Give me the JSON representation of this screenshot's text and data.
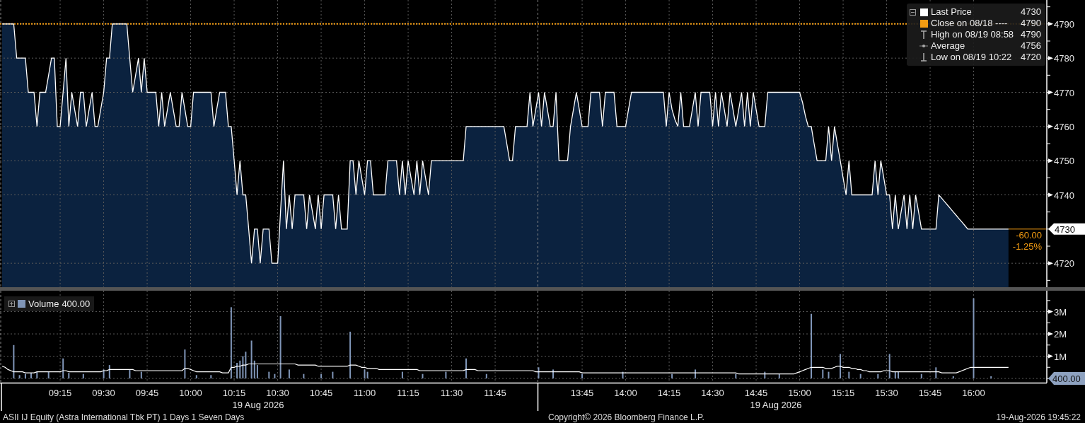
{
  "price_chart": {
    "legend": [
      {
        "kind": "series",
        "value": "4730"
      },
      {
        "kind": "swatch",
        "label": "Close on 08/18 ----",
        "value": "4790",
        "color": "#f39c12"
      },
      {
        "kind": "high",
        "label": "High on 08/19 08:58",
        "value": "4790"
      },
      {
        "kind": "average",
        "label": "Average",
        "value": "4756"
      },
      {
        "kind": "low",
        "label": "Low on 08/19 10:22",
        "value": "4720"
      }
    ],
    "last_price_tag": "4730",
    "change": "-60.00",
    "change_percent": "-1.25%",
    "chart_data": {
      "type": "area",
      "grid": true,
      "ylim": [
        4713,
        4797
      ],
      "yticks": [
        4720,
        4740,
        4750,
        4760,
        4770,
        4780,
        4790
      ],
      "ref_lines": [
        {
          "axis": "y",
          "value": 4790,
          "color": "#f39c12"
        }
      ],
      "categories": [
        null,
        null,
        null,
        null,
        null,
        null,
        null,
        null,
        null,
        null,
        null,
        null,
        null,
        null,
        null,
        null,
        null,
        null,
        null,
        null,
        null,
        null,
        null,
        null,
        null,
        null,
        null,
        null,
        null,
        null,
        null,
        null,
        null,
        null,
        null,
        null,
        null,
        null,
        null,
        null,
        null,
        null,
        null,
        null,
        null,
        null,
        null,
        null,
        null,
        null,
        null,
        null,
        null,
        null,
        null,
        null,
        null,
        null,
        null,
        null,
        null,
        null,
        null,
        null,
        null,
        null,
        null,
        null,
        null,
        null,
        null,
        null,
        null,
        null,
        null,
        null,
        null,
        null,
        null,
        null,
        null,
        null,
        null,
        null,
        null,
        null,
        null,
        null,
        null,
        null,
        null,
        null,
        null,
        null,
        null,
        null,
        null,
        null,
        null,
        null,
        null,
        null,
        null,
        null,
        null,
        null,
        null,
        null,
        null,
        null,
        null,
        null,
        null,
        null,
        null,
        null,
        null,
        null,
        null,
        null,
        null,
        null,
        null,
        null,
        null,
        null,
        null,
        null,
        null,
        null,
        null,
        null,
        null,
        null,
        null,
        null,
        null,
        null,
        null,
        null,
        null,
        null,
        null,
        null,
        null,
        null,
        null,
        null,
        null,
        null,
        null,
        null,
        null,
        null,
        null,
        null,
        null,
        null,
        null,
        null,
        null,
        null,
        null,
        null,
        null,
        null,
        null,
        null,
        null,
        null,
        null,
        null,
        null,
        null,
        null,
        null,
        null,
        null,
        null,
        null,
        null,
        null,
        null,
        null,
        null,
        null,
        null,
        null,
        null,
        null,
        null,
        null,
        null,
        null,
        null,
        null,
        null,
        null,
        null,
        null,
        null,
        null,
        null,
        null,
        null,
        null,
        null,
        null,
        null,
        null,
        null,
        null,
        null,
        null,
        null,
        null,
        null,
        null,
        null,
        null,
        null,
        null,
        null,
        null,
        null,
        null,
        null,
        null,
        null,
        null,
        null,
        null,
        null,
        null,
        null,
        null,
        null,
        null,
        null,
        null,
        null,
        null,
        null,
        null,
        null,
        null,
        null,
        null,
        null,
        null,
        null,
        null,
        null,
        null,
        null,
        null,
        null,
        null,
        null,
        null,
        null,
        null,
        null,
        null,
        null,
        null,
        null,
        null,
        null,
        null,
        null,
        null,
        null,
        null,
        null,
        null,
        null,
        null,
        null,
        null,
        null,
        null,
        null,
        null,
        null,
        null,
        null,
        null,
        null,
        null,
        null,
        null,
        null,
        null,
        null,
        null,
        null,
        null,
        null,
        null,
        null,
        null,
        null,
        null,
        null,
        null,
        null,
        null,
        null,
        null,
        null,
        null,
        null,
        null,
        null,
        null,
        null,
        null,
        null,
        null,
        null,
        null,
        null,
        null,
        null,
        null,
        null,
        null,
        null,
        null,
        null,
        null,
        null,
        null,
        null,
        null,
        null,
        null,
        null,
        null,
        null,
        null,
        null,
        null,
        null,
        null,
        null,
        null,
        null,
        null,
        null,
        null,
        null,
        null,
        null,
        null,
        null,
        null,
        null,
        null
      ],
      "series": [
        {
          "name": "Last Price",
          "color": "#ffffff",
          "values": [
            4790,
            4790,
            4790,
            4790,
            4790,
            4780,
            4780,
            4780,
            4780,
            4770,
            4770,
            4770,
            4760,
            4770,
            4770,
            4770,
            4775,
            4780,
            4780,
            4760,
            4760,
            4770,
            4780,
            4760,
            4770,
            4765,
            4760,
            4770,
            4770,
            4760,
            4765,
            4770,
            4760,
            4760,
            4765,
            4770,
            4780,
            4780,
            4790,
            4790,
            4790,
            4790,
            4790,
            4790,
            4780,
            4770,
            4775,
            4780,
            4770,
            4780,
            4770,
            4770,
            4770,
            4770,
            4760,
            4770,
            4760,
            4765,
            4770,
            4765,
            4760,
            4760,
            4770,
            4765,
            4760,
            4760,
            4770,
            4770,
            4770,
            4770,
            4770,
            4770,
            4770,
            4760,
            4765,
            4770,
            4770,
            4770,
            4760,
            4760,
            4750,
            4740,
            4750,
            4740,
            4740,
            4730,
            4720,
            4730,
            4730,
            4720,
            4730,
            4730,
            4730,
            4720,
            4720,
            4720,
            4735,
            4750,
            4730,
            4740,
            4730,
            4740,
            4740,
            4740,
            4740,
            4730,
            4740,
            4735,
            4730,
            4740,
            4730,
            4740,
            4740,
            4740,
            4740,
            4730,
            4740,
            4730,
            4730,
            4730,
            4750,
            4750,
            4740,
            4750,
            4745,
            4740,
            4750,
            4750,
            4740,
            4740,
            4740,
            4740,
            4740,
            4750,
            4750,
            4750,
            4750,
            4740,
            4750,
            4740,
            4750,
            4745,
            4740,
            4750,
            4740,
            4750,
            4745,
            4740,
            4750,
            4750,
            4750,
            4750,
            4750,
            4750,
            4750,
            4750,
            4750,
            4750,
            4750,
            4750,
            4760,
            4760,
            4760,
            4760,
            4760,
            4760,
            4760,
            4760,
            4760,
            4760,
            4760,
            4760,
            4760,
            4760,
            4755,
            4750,
            4750,
            4760,
            4760,
            4760,
            4760,
            4760,
            4770,
            4760,
            4765,
            4770,
            4760,
            4770,
            4765,
            4760,
            4760,
            4770,
            4750,
            4750,
            4750,
            4750,
            4760,
            4765,
            4770,
            4765,
            4760,
            4760,
            4760,
            4770,
            4770,
            4770,
            4770,
            4760,
            4770,
            4770,
            4770,
            4770,
            4760,
            4760,
            4760,
            4760,
            4765,
            4770,
            4770,
            4770,
            4770,
            4770,
            4770,
            4770,
            4770,
            4770,
            4770,
            4770,
            4770,
            4760,
            4770,
            4765,
            4762,
            4760,
            4770,
            4760,
            4760,
            4760,
            4765,
            4770,
            4760,
            4770,
            4770,
            4770,
            4770,
            4760,
            4770,
            4760,
            4770,
            4765,
            4760,
            4770,
            4765,
            4760,
            4765,
            4770,
            4760,
            4770,
            4760,
            4770,
            4765,
            4760,
            4760,
            4760,
            4770,
            4770,
            4770,
            4770,
            4770,
            4770,
            4770,
            4770,
            4770,
            4770,
            4770,
            4770,
            4767,
            4763,
            4760,
            4760,
            4755,
            4750,
            4750,
            4750,
            4750,
            4760,
            4750,
            4760,
            4755,
            4750,
            4745,
            4740,
            4750,
            4740,
            4740,
            4740,
            4740,
            4740,
            4740,
            4740,
            4740,
            4750,
            4740,
            4750,
            4745,
            4740,
            4740,
            4730,
            4740,
            4730,
            4735,
            4740,
            4730,
            4740,
            4730,
            4740,
            4735,
            4730,
            4730,
            4730,
            4730,
            4730,
            4730,
            4740,
            4739,
            4738,
            4737,
            4736,
            4735,
            4734,
            4733,
            4732,
            4731,
            4730,
            4730,
            4730,
            4730,
            4730,
            4730,
            4730,
            4730,
            4730,
            4730,
            4730,
            4730,
            4730,
            4730,
            4730,
            null,
            null,
            null,
            null,
            null,
            null,
            null,
            null,
            null,
            null,
            null,
            null
          ]
        }
      ]
    }
  },
  "volume_chart": {
    "legend": {
      "value": "400.00"
    },
    "last_volume_tag": "400.00",
    "chart_data": {
      "type": "bar",
      "grid": true,
      "ylim": [
        0,
        3940000
      ],
      "yticks": [
        {
          "value": 1000000,
          "label": "1M"
        },
        {
          "value": 2000000,
          "label": "2M"
        },
        {
          "value": 3000000,
          "label": "3M"
        }
      ],
      "categories": [
        null,
        null,
        null,
        null,
        null,
        null,
        null,
        null,
        null,
        null,
        null,
        null,
        null,
        null,
        null,
        null,
        null,
        null,
        null,
        null,
        "09:15",
        null,
        null,
        null,
        null,
        null,
        null,
        null,
        null,
        null,
        null,
        null,
        null,
        null,
        null,
        "09:30",
        null,
        null,
        null,
        null,
        null,
        null,
        null,
        null,
        null,
        null,
        null,
        null,
        null,
        null,
        "09:45",
        null,
        null,
        null,
        null,
        null,
        null,
        null,
        null,
        null,
        null,
        null,
        null,
        null,
        null,
        "10:00",
        null,
        null,
        null,
        null,
        null,
        null,
        null,
        null,
        null,
        null,
        null,
        null,
        null,
        null,
        "10:15",
        null,
        null,
        null,
        null,
        null,
        null,
        null,
        null,
        null,
        null,
        null,
        null,
        null,
        null,
        "10:30",
        null,
        null,
        null,
        null,
        null,
        null,
        null,
        null,
        null,
        null,
        null,
        null,
        null,
        null,
        "10:45",
        null,
        null,
        null,
        null,
        null,
        null,
        null,
        null,
        null,
        null,
        null,
        null,
        null,
        null,
        "11:00",
        null,
        null,
        null,
        null,
        null,
        null,
        null,
        null,
        null,
        null,
        null,
        null,
        null,
        null,
        "11:15",
        null,
        null,
        null,
        null,
        null,
        null,
        null,
        null,
        null,
        null,
        null,
        null,
        null,
        null,
        "11:30",
        null,
        null,
        null,
        null,
        null,
        null,
        null,
        null,
        null,
        null,
        null,
        null,
        null,
        null,
        "11:45",
        null,
        null,
        null,
        null,
        null,
        null,
        null,
        null,
        null,
        null,
        null,
        null,
        null,
        null,
        null,
        null,
        null,
        null,
        null,
        null,
        null,
        null,
        null,
        null,
        null,
        null,
        null,
        null,
        null,
        "13:45",
        null,
        null,
        null,
        null,
        null,
        null,
        null,
        null,
        null,
        null,
        null,
        null,
        null,
        null,
        "14:00",
        null,
        null,
        null,
        null,
        null,
        null,
        null,
        null,
        null,
        null,
        null,
        null,
        null,
        null,
        "14:15",
        null,
        null,
        null,
        null,
        null,
        null,
        null,
        null,
        null,
        null,
        null,
        null,
        null,
        null,
        "14:30",
        null,
        null,
        null,
        null,
        null,
        null,
        null,
        null,
        null,
        null,
        null,
        null,
        null,
        null,
        "14:45",
        null,
        null,
        null,
        null,
        null,
        null,
        null,
        null,
        null,
        null,
        null,
        null,
        null,
        null,
        "15:00",
        null,
        null,
        null,
        null,
        null,
        null,
        null,
        null,
        null,
        null,
        null,
        null,
        null,
        null,
        "15:15",
        null,
        null,
        null,
        null,
        null,
        null,
        null,
        null,
        null,
        null,
        null,
        null,
        null,
        null,
        "15:30",
        null,
        null,
        null,
        null,
        null,
        null,
        null,
        null,
        null,
        null,
        null,
        null,
        null,
        null,
        "15:45",
        null,
        null,
        null,
        null,
        null,
        null,
        null,
        null,
        null,
        null,
        null,
        null,
        null,
        null,
        "16:00",
        null,
        null,
        null,
        null,
        null,
        null,
        null,
        null,
        null,
        null,
        null,
        null,
        null,
        null,
        null,
        null,
        null,
        null,
        null,
        null,
        null,
        null,
        null,
        null
      ],
      "series": [
        {
          "name": "Volume",
          "color": "#8096b8",
          "values": [
            null,
            null,
            null,
            null,
            1500000,
            null,
            150000,
            null,
            200000,
            null,
            250000,
            null,
            300000,
            null,
            null,
            null,
            300000,
            null,
            null,
            null,
            null,
            900000,
            null,
            250000,
            null,
            null,
            null,
            null,
            200000,
            null,
            null,
            null,
            null,
            null,
            null,
            400000,
            null,
            600000,
            null,
            null,
            null,
            null,
            null,
            null,
            400000,
            null,
            null,
            null,
            300000,
            null,
            null,
            null,
            null,
            null,
            null,
            null,
            null,
            null,
            null,
            null,
            null,
            null,
            null,
            1300000,
            null,
            null,
            null,
            150000,
            null,
            null,
            null,
            null,
            150000,
            null,
            null,
            null,
            null,
            null,
            null,
            3200000,
            null,
            700000,
            800000,
            1000000,
            1200000,
            null,
            1700000,
            800000,
            600000,
            null,
            null,
            null,
            300000,
            null,
            200000,
            null,
            2800000,
            null,
            null,
            400000,
            null,
            null,
            null,
            null,
            200000,
            null,
            null,
            null,
            null,
            null,
            200000,
            null,
            null,
            null,
            300000,
            null,
            null,
            null,
            null,
            null,
            2100000,
            null,
            null,
            null,
            null,
            400000,
            300000,
            null,
            null,
            null,
            null,
            null,
            null,
            null,
            null,
            null,
            null,
            null,
            300000,
            null,
            null,
            null,
            null,
            null,
            null,
            200000,
            null,
            null,
            null,
            null,
            null,
            null,
            null,
            300000,
            null,
            null,
            null,
            null,
            null,
            null,
            900000,
            null,
            null,
            null,
            null,
            null,
            null,
            200000,
            null,
            null,
            null,
            null,
            null,
            null,
            null,
            null,
            null,
            null,
            null,
            null,
            null,
            null,
            null,
            null,
            null,
            500000,
            null,
            null,
            null,
            null,
            400000,
            null,
            null,
            null,
            null,
            null,
            null,
            null,
            null,
            null,
            200000,
            null,
            null,
            null,
            null,
            null,
            null,
            null,
            null,
            null,
            null,
            null,
            null,
            null,
            300000,
            null,
            null,
            null,
            null,
            null,
            null,
            null,
            null,
            null,
            null,
            null,
            null,
            null,
            null,
            null,
            null,
            200000,
            null,
            null,
            null,
            null,
            null,
            null,
            null,
            400000,
            null,
            null,
            null,
            null,
            null,
            null,
            null,
            null,
            null,
            null,
            null,
            null,
            null,
            200000,
            null,
            null,
            null,
            null,
            null,
            null,
            null,
            null,
            null,
            300000,
            null,
            null,
            null,
            null,
            200000,
            null,
            null,
            null,
            null,
            null,
            null,
            null,
            null,
            null,
            null,
            2900000,
            null,
            null,
            null,
            400000,
            null,
            300000,
            null,
            null,
            null,
            1100000,
            null,
            null,
            300000,
            null,
            null,
            null,
            200000,
            null,
            null,
            null,
            null,
            null,
            200000,
            null,
            null,
            null,
            1100000,
            null,
            300000,
            300000,
            null,
            null,
            null,
            null,
            null,
            null,
            null,
            200000,
            null,
            null,
            null,
            null,
            500000,
            null,
            null,
            null,
            null,
            null,
            100000,
            null,
            null,
            null,
            null,
            null,
            null,
            3600000,
            null,
            null,
            null,
            null,
            null,
            100000,
            null,
            null,
            null,
            null,
            null,
            null,
            null,
            null,
            null,
            null,
            null,
            null,
            null,
            null,
            null,
            null,
            null,
            null
          ]
        },
        {
          "type": "line",
          "color": "#ffffff",
          "values": [
            550000,
            500000,
            400000,
            350000,
            300000,
            300000,
            300000,
            300000,
            250000,
            250000,
            250000,
            250000,
            300000,
            300000,
            300000,
            300000,
            300000,
            300000,
            300000,
            300000,
            300000,
            350000,
            350000,
            300000,
            300000,
            300000,
            300000,
            300000,
            300000,
            300000,
            300000,
            300000,
            300000,
            300000,
            300000,
            350000,
            350000,
            400000,
            400000,
            400000,
            400000,
            400000,
            400000,
            400000,
            400000,
            400000,
            350000,
            350000,
            350000,
            350000,
            350000,
            350000,
            350000,
            350000,
            350000,
            350000,
            350000,
            350000,
            350000,
            350000,
            350000,
            350000,
            350000,
            450000,
            450000,
            400000,
            350000,
            300000,
            300000,
            300000,
            300000,
            300000,
            300000,
            300000,
            300000,
            300000,
            250000,
            250000,
            250000,
            500000,
            500000,
            550000,
            550000,
            600000,
            600000,
            650000,
            650000,
            650000,
            650000,
            650000,
            650000,
            650000,
            650000,
            650000,
            650000,
            650000,
            650000,
            650000,
            650000,
            650000,
            650000,
            650000,
            600000,
            600000,
            600000,
            600000,
            600000,
            600000,
            600000,
            550000,
            550000,
            550000,
            550000,
            550000,
            550000,
            550000,
            550000,
            550000,
            550000,
            550000,
            600000,
            600000,
            600000,
            550000,
            500000,
            500000,
            450000,
            450000,
            450000,
            450000,
            400000,
            400000,
            400000,
            400000,
            400000,
            400000,
            400000,
            400000,
            400000,
            400000,
            400000,
            400000,
            400000,
            400000,
            350000,
            350000,
            350000,
            350000,
            350000,
            350000,
            350000,
            350000,
            350000,
            350000,
            350000,
            350000,
            350000,
            350000,
            350000,
            350000,
            400000,
            400000,
            400000,
            400000,
            350000,
            350000,
            350000,
            350000,
            350000,
            350000,
            350000,
            350000,
            350000,
            350000,
            350000,
            350000,
            350000,
            350000,
            350000,
            350000,
            350000,
            350000,
            350000,
            350000,
            300000,
            300000,
            300000,
            300000,
            300000,
            300000,
            300000,
            300000,
            300000,
            300000,
            300000,
            300000,
            300000,
            300000,
            300000,
            300000,
            250000,
            250000,
            250000,
            250000,
            250000,
            250000,
            250000,
            250000,
            250000,
            250000,
            250000,
            250000,
            250000,
            250000,
            250000,
            250000,
            250000,
            250000,
            250000,
            250000,
            250000,
            250000,
            250000,
            250000,
            250000,
            250000,
            250000,
            250000,
            250000,
            250000,
            250000,
            250000,
            250000,
            250000,
            250000,
            250000,
            250000,
            250000,
            250000,
            250000,
            250000,
            250000,
            250000,
            250000,
            250000,
            250000,
            250000,
            250000,
            250000,
            250000,
            250000,
            250000,
            250000,
            250000,
            200000,
            200000,
            200000,
            200000,
            200000,
            200000,
            200000,
            200000,
            200000,
            200000,
            200000,
            200000,
            200000,
            200000,
            200000,
            200000,
            200000,
            200000,
            200000,
            200000,
            250000,
            300000,
            350000,
            400000,
            450000,
            500000,
            500000,
            500000,
            500000,
            500000,
            450000,
            450000,
            450000,
            500000,
            550000,
            550000,
            500000,
            500000,
            500000,
            450000,
            450000,
            400000,
            400000,
            350000,
            350000,
            300000,
            300000,
            300000,
            300000,
            300000,
            350000,
            350000,
            350000,
            300000,
            300000,
            300000,
            300000,
            300000,
            300000,
            300000,
            300000,
            300000,
            300000,
            300000,
            300000,
            300000,
            300000,
            300000,
            300000,
            300000,
            250000,
            250000,
            250000,
            250000,
            250000,
            250000,
            300000,
            350000,
            400000,
            450000,
            500000,
            500000,
            500000,
            500000,
            500000,
            500000,
            500000,
            500000,
            500000,
            500000,
            500000,
            500000,
            500000,
            500000,
            null,
            null,
            null,
            null,
            null,
            null,
            null,
            null,
            null,
            null,
            null,
            null
          ]
        }
      ]
    }
  },
  "time_axis": {
    "dates": [
      "19 Aug 2026",
      "19 Aug 2026"
    ]
  },
  "footer": {
    "security": "ASII IJ Equity (Astra International Tbk PT) 1 Days 1 Seven Days",
    "copyright": "Copyright© 2026 Bloomberg Finance L.P.",
    "timestamp": "19-Aug-2026 19:45:22"
  }
}
